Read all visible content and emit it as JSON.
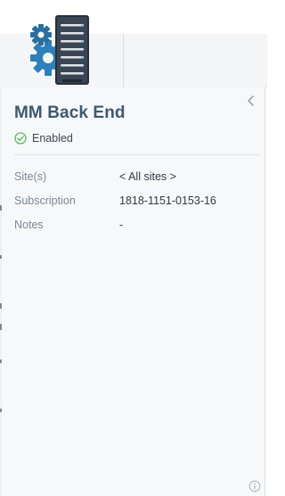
{
  "panel": {
    "title": "MM Back End",
    "status": {
      "label": "Enabled",
      "icon": "check-circle-icon",
      "color": "#5cb85c"
    },
    "details": [
      {
        "label": "Site(s)",
        "value": "< All sites >"
      },
      {
        "label": "Subscription",
        "value": "1818-1151-0153-16"
      },
      {
        "label": "Notes",
        "value": "-"
      }
    ]
  },
  "icons": {
    "server": "server-gears-icon",
    "collapse": "chevron-left-icon",
    "info": "info-icon"
  },
  "colors": {
    "title": "#3e5870",
    "label": "#7b8893",
    "value": "#2f3b45",
    "panel_bg": "#f6f8fa",
    "gear_blue": "#2f7fb8"
  }
}
